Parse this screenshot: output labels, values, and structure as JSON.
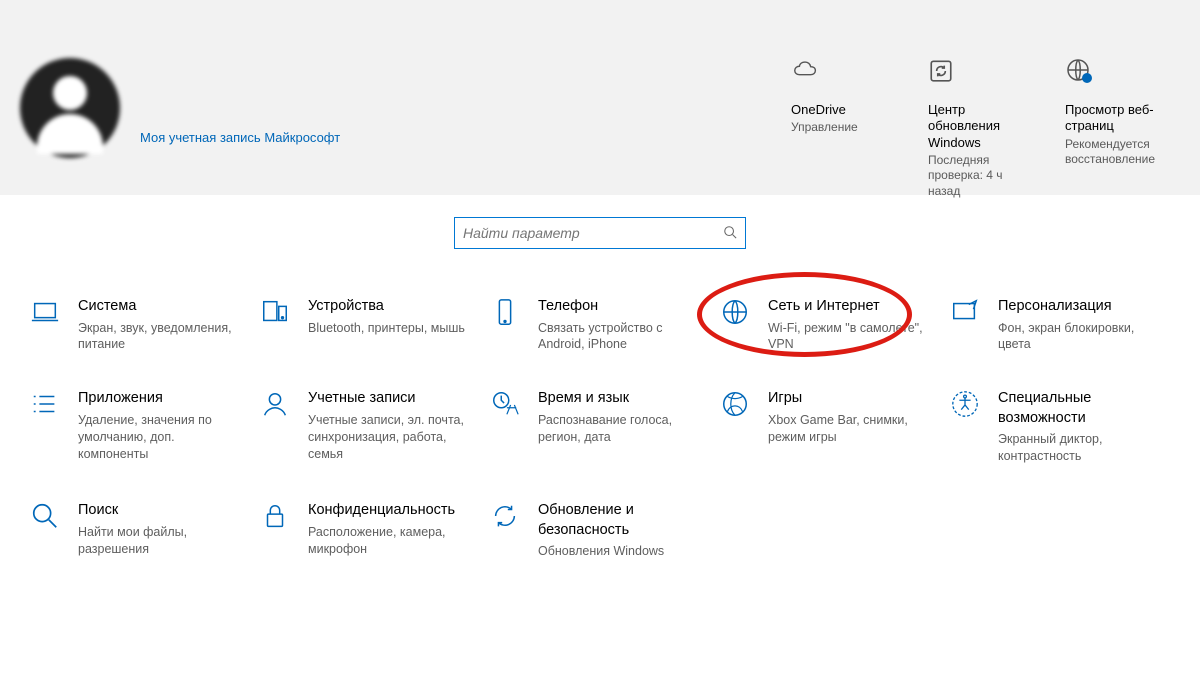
{
  "user": {
    "ms_account_link": "Моя учетная запись Майкрософт"
  },
  "status_cards": [
    {
      "id": "onedrive",
      "title": "OneDrive",
      "sub": "Управление"
    },
    {
      "id": "update",
      "title": "Центр обновления Windows",
      "sub": "Последняя проверка: 4 ч назад"
    },
    {
      "id": "browse",
      "title": "Просмотр веб-страниц",
      "sub": "Рекомендуется восстановление"
    }
  ],
  "search": {
    "placeholder": "Найти параметр"
  },
  "tiles": [
    {
      "id": "system",
      "title": "Система",
      "desc": "Экран, звук, уведомления, питание"
    },
    {
      "id": "devices",
      "title": "Устройства",
      "desc": "Bluetooth, принтеры, мышь"
    },
    {
      "id": "phone",
      "title": "Телефон",
      "desc": "Связать устройство с Android, iPhone"
    },
    {
      "id": "network",
      "title": "Сеть и Интернет",
      "desc": "Wi-Fi, режим \"в самолете\", VPN",
      "highlight": true
    },
    {
      "id": "person",
      "title": "Персонализация",
      "desc": "Фон, экран блокировки, цвета"
    },
    {
      "id": "apps",
      "title": "Приложения",
      "desc": "Удаление, значения по умолчанию, доп. компоненты"
    },
    {
      "id": "accounts",
      "title": "Учетные записи",
      "desc": "Учетные записи, эл. почта, синхронизация, работа, семья"
    },
    {
      "id": "time",
      "title": "Время и язык",
      "desc": "Распознавание голоса, регион, дата"
    },
    {
      "id": "gaming",
      "title": "Игры",
      "desc": "Xbox Game Bar, снимки, режим игры"
    },
    {
      "id": "ease",
      "title": "Специальные возможности",
      "desc": "Экранный диктор, контрастность"
    },
    {
      "id": "search",
      "title": "Поиск",
      "desc": "Найти мои файлы, разрешения"
    },
    {
      "id": "privacy",
      "title": "Конфиденциальность",
      "desc": "Расположение, камера, микрофон"
    },
    {
      "id": "updsec",
      "title": "Обновление и безопасность",
      "desc": "Обновления Windows"
    }
  ]
}
